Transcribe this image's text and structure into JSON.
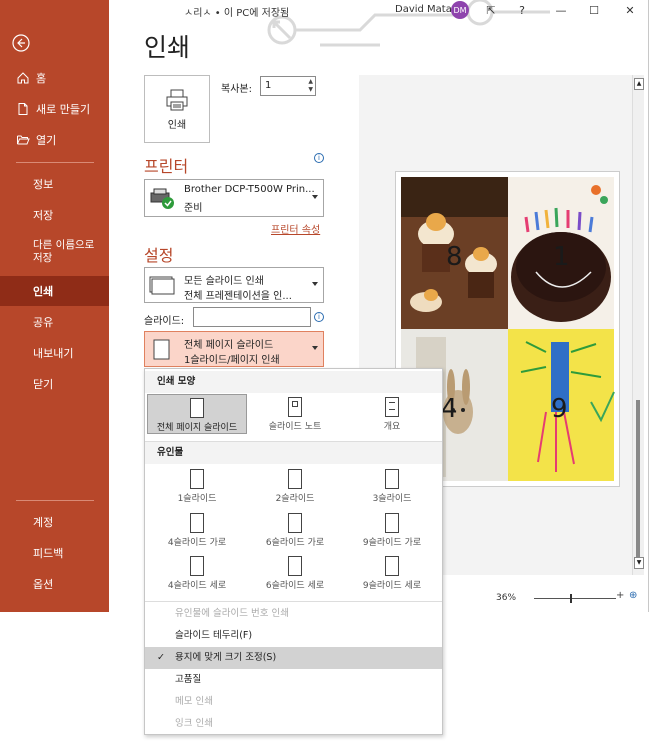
{
  "titlebar": {
    "text": "ㅅ리ㅅ • 이 PC에 저장됨",
    "user_name": "David Mata",
    "user_initials": "DM"
  },
  "sidebar": {
    "items": [
      {
        "label": "홈",
        "icon": "home-icon"
      },
      {
        "label": "새로 만들기",
        "icon": "new-document-icon"
      },
      {
        "label": "열기",
        "icon": "folder-open-icon"
      },
      {
        "label": "정보"
      },
      {
        "label": "저장"
      },
      {
        "label": "다른 이름으로 저장"
      },
      {
        "label": "인쇄"
      },
      {
        "label": "공유"
      },
      {
        "label": "내보내기"
      },
      {
        "label": "닫기"
      },
      {
        "label": "계정"
      },
      {
        "label": "피드백"
      },
      {
        "label": "옵션"
      }
    ]
  },
  "main": {
    "title": "인쇄",
    "print_button": "인쇄",
    "copies_label": "복사본:",
    "copies_value": "1",
    "printer_header": "프린터",
    "printer_name": "Brother DCP-T500W Prin...",
    "printer_status": "준비",
    "printer_properties": "프린터 속성",
    "settings_header": "설정",
    "print_range_l1": "모든 슬라이드 인쇄",
    "print_range_l2": "전체 프레젠테이션을 인...",
    "slides_label": "슬라이드:",
    "layout_l1": "전체 페이지 슬라이드",
    "layout_l2": "1슬라이드/페이지 인쇄"
  },
  "preview": {
    "slide_numbers": [
      "8",
      "1",
      "4",
      "9"
    ],
    "zoom": "36%"
  },
  "popup": {
    "print_layout_header": "인쇄 모양",
    "print_layouts": [
      "전체 페이지 슬라이드",
      "슬라이드 노트",
      "개요"
    ],
    "handouts_header": "유인물",
    "handouts": [
      "1슬라이드",
      "2슬라이드",
      "3슬라이드",
      "4슬라이드 가로",
      "6슬라이드 가로",
      "9슬라이드 가로",
      "4슬라이드 세로",
      "6슬라이드 세로",
      "9슬라이드 세로"
    ],
    "options": [
      {
        "label": "유인물에 슬라이드 번호 인쇄",
        "disabled": true
      },
      {
        "label": "슬라이드 테두리(F)",
        "disabled": false
      },
      {
        "label": "용지에 맞게 크기 조정(S)",
        "disabled": false,
        "checked": true
      },
      {
        "label": "고품질",
        "disabled": false
      },
      {
        "label": "메모 인쇄",
        "disabled": true
      },
      {
        "label": "잉크 인쇄",
        "disabled": true
      }
    ]
  },
  "colors": {
    "accent": "#b7472a",
    "accent_dark": "#8f2c17"
  }
}
